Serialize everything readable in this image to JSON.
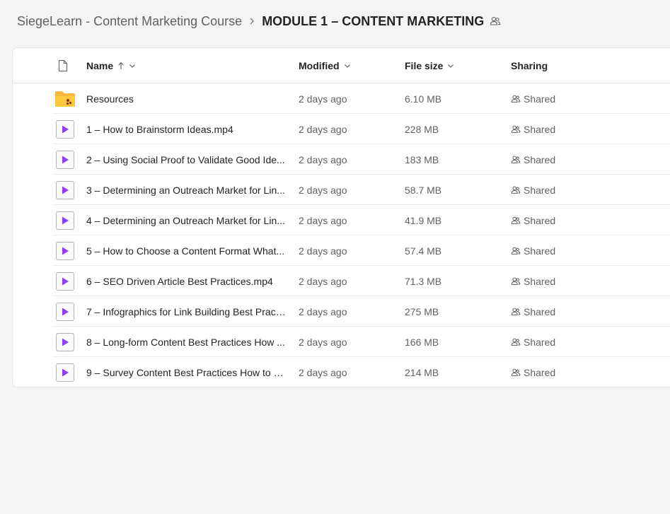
{
  "breadcrumb": {
    "parent": "SiegeLearn - Content Marketing Course",
    "current": "MODULE 1 – CONTENT MARKETING"
  },
  "columns": {
    "name": "Name",
    "modified": "Modified",
    "size": "File size",
    "sharing": "Sharing"
  },
  "colors": {
    "video_accent": "#8a3ffc",
    "folder": "#f6b93b"
  },
  "files": [
    {
      "type": "folder-icon",
      "name": "Resources",
      "modified": "2 days ago",
      "size": "6.10 MB",
      "sharing": "Shared"
    },
    {
      "type": "video-icon",
      "name": "1 – How to Brainstorm Ideas.mp4",
      "modified": "2 days ago",
      "size": "228 MB",
      "sharing": "Shared"
    },
    {
      "type": "video-icon",
      "name": "2 – Using Social Proof to Validate Good Ide...",
      "modified": "2 days ago",
      "size": "183 MB",
      "sharing": "Shared"
    },
    {
      "type": "video-icon",
      "name": "3 – Determining an Outreach Market for Lin...",
      "modified": "2 days ago",
      "size": "58.7 MB",
      "sharing": "Shared"
    },
    {
      "type": "video-icon",
      "name": "4 – Determining an Outreach Market for Lin...",
      "modified": "2 days ago",
      "size": "41.9 MB",
      "sharing": "Shared"
    },
    {
      "type": "video-icon",
      "name": "5 – How to Choose a Content Format What...",
      "modified": "2 days ago",
      "size": "57.4 MB",
      "sharing": "Shared"
    },
    {
      "type": "video-icon",
      "name": "6 – SEO Driven Article Best Practices.mp4",
      "modified": "2 days ago",
      "size": "71.3 MB",
      "sharing": "Shared"
    },
    {
      "type": "video-icon",
      "name": "7 – Infographics for Link Building Best Pract...",
      "modified": "2 days ago",
      "size": "275 MB",
      "sharing": "Shared"
    },
    {
      "type": "video-icon",
      "name": "8 – Long-form Content Best Practices How ...",
      "modified": "2 days ago",
      "size": "166 MB",
      "sharing": "Shared"
    },
    {
      "type": "video-icon",
      "name": "9 – Survey Content Best Practices How to Bl...",
      "modified": "2 days ago",
      "size": "214 MB",
      "sharing": "Shared"
    }
  ]
}
